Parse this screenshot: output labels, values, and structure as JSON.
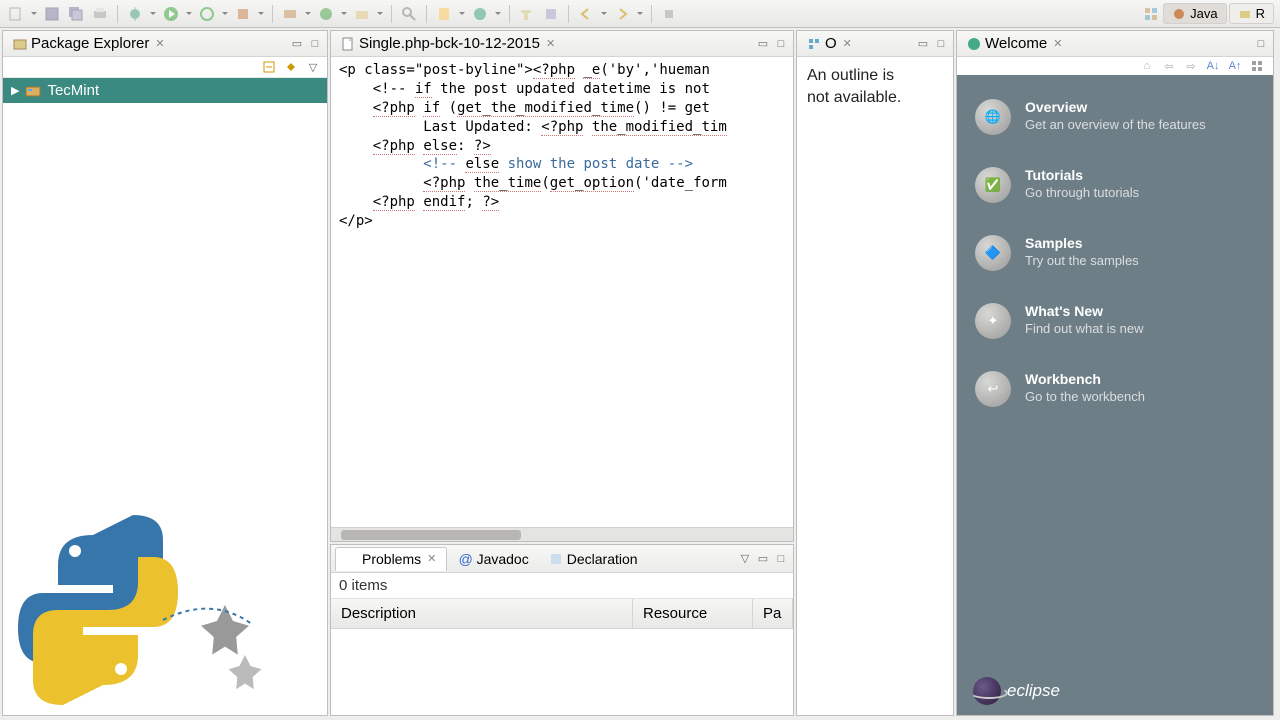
{
  "perspectives": {
    "java": "Java",
    "r": "R"
  },
  "package_explorer": {
    "title": "Package Explorer",
    "tree": {
      "project": "TecMint"
    }
  },
  "editor": {
    "tab_title": "Single.php-bck-10-12-2015",
    "code_lines": [
      "<p class=\"post-byline\"><?php _e('by','hueman",
      "    <!-- if the post updated datetime is not",
      "    <?php if (get_the_modified_time() != get",
      "          Last Updated: <?php the_modified_tim",
      "    <?php else: ?>",
      "          <!-- else show the post date -->",
      "          <?php the_time(get_option('date_form",
      "    <?php endif; ?>",
      "</p>"
    ]
  },
  "outline": {
    "title": "O",
    "message_l1": "An outline is",
    "message_l2": "not available."
  },
  "welcome": {
    "title": "Welcome",
    "items": [
      {
        "title": "Overview",
        "desc": "Get an overview of the features"
      },
      {
        "title": "Tutorials",
        "desc": "Go through tutorials"
      },
      {
        "title": "Samples",
        "desc": "Try out the samples"
      },
      {
        "title": "What's New",
        "desc": "Find out what is new"
      },
      {
        "title": "Workbench",
        "desc": "Go to the workbench"
      }
    ],
    "footer": "eclipse"
  },
  "bottom": {
    "tabs": {
      "problems": "Problems",
      "javadoc": "Javadoc",
      "declaration": "Declaration"
    },
    "problems_count": "0 items",
    "cols": {
      "description": "Description",
      "resource": "Resource",
      "path": "Pa"
    }
  }
}
